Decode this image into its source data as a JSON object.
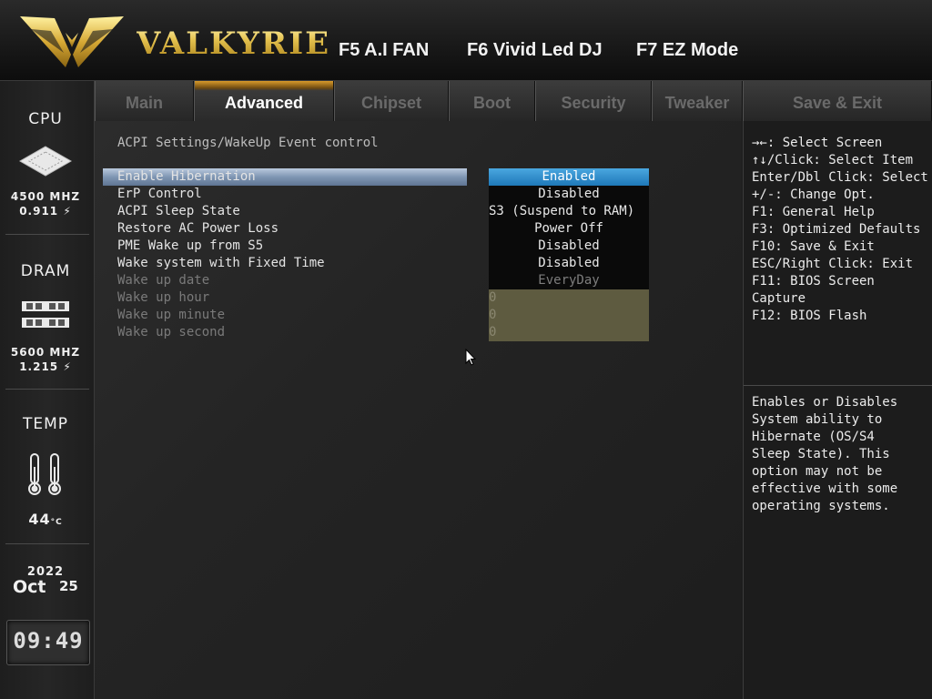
{
  "header": {
    "brand": "VALKYRIE",
    "hotkeys": [
      "F5 A.I FAN",
      "F6 Vivid Led DJ",
      "F7 EZ Mode"
    ]
  },
  "sidebar": {
    "cpu": {
      "label": "CPU",
      "freq": "4500 MHZ",
      "volt": "0.911"
    },
    "dram": {
      "label": "DRAM",
      "freq": "5600 MHZ",
      "volt": "1.215"
    },
    "temp": {
      "label": "TEMP",
      "value": "44"
    },
    "date": {
      "year": "2022",
      "month": "Oct",
      "day": "25"
    },
    "clock": "09:49"
  },
  "tabs": [
    {
      "label": "Main",
      "active": false
    },
    {
      "label": "Advanced",
      "active": true
    },
    {
      "label": "Chipset",
      "active": false
    },
    {
      "label": "Boot",
      "active": false
    },
    {
      "label": "Security",
      "active": false
    },
    {
      "label": "Tweaker",
      "active": false
    },
    {
      "label": "Save & Exit",
      "active": false
    }
  ],
  "main": {
    "section_title": "ACPI Settings/WakeUp Event control",
    "settings": [
      {
        "label": "Enable Hibernation",
        "value": "Enabled"
      },
      {
        "label": "ErP Control",
        "value": "Disabled"
      },
      {
        "label": "ACPI Sleep State",
        "value": "S3 (Suspend to RAM)"
      },
      {
        "label": "Restore AC Power Loss",
        "value": "Power Off"
      },
      {
        "label": "PME Wake up from S5",
        "value": "Disabled"
      },
      {
        "label": "Wake system with Fixed Time",
        "value": "Disabled"
      },
      {
        "label": "Wake up date",
        "value": "EveryDay"
      },
      {
        "label": "Wake up hour",
        "value": "0"
      },
      {
        "label": "Wake up minute",
        "value": "0"
      },
      {
        "label": "Wake up second",
        "value": "0"
      }
    ]
  },
  "help": {
    "keys": [
      "→←: Select Screen",
      "↑↓/Click: Select Item",
      "Enter/Dbl Click: Select",
      "+/-: Change Opt.",
      "F1: General Help",
      "F3: Optimized Defaults",
      "F10: Save & Exit",
      "ESC/Right Click: Exit",
      "F11: BIOS Screen",
      "Capture",
      "F12: BIOS Flash"
    ],
    "description": [
      "Enables or Disables",
      "System ability to",
      "Hibernate (OS/S4",
      "Sleep State). This",
      "option may not be",
      "effective with some",
      "operating systems."
    ]
  },
  "colors": {
    "accent_gold": "#d4b13a",
    "selected_value": "#1e78b8",
    "selected_row": "#7f96b3"
  }
}
